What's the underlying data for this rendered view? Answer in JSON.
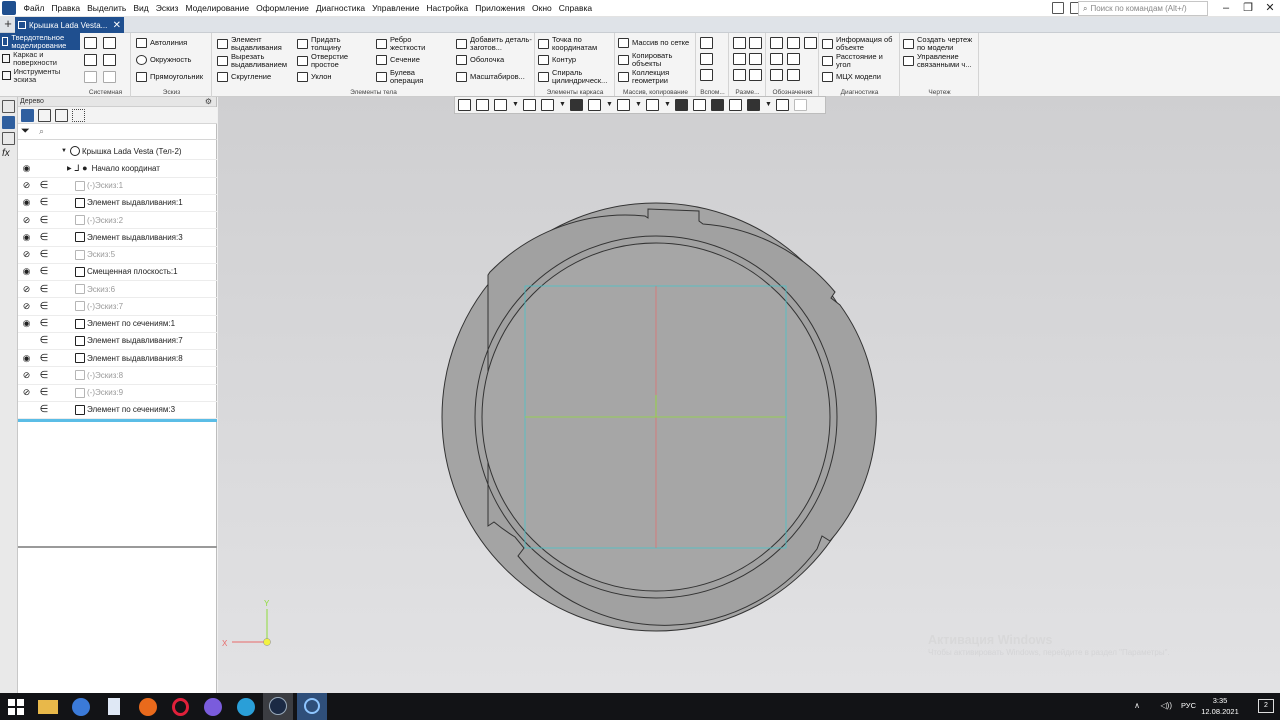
{
  "menubar": {
    "items": [
      "Файл",
      "Правка",
      "Выделить",
      "Вид",
      "Эскиз",
      "Моделирование",
      "Оформление",
      "Диагностика",
      "Управление",
      "Настройка",
      "Приложения",
      "Окно",
      "Справка"
    ],
    "search_placeholder": "Поиск по командам (Alt+/)"
  },
  "tabbar": {
    "doc_tab": "Крышка Lada Vesta...",
    "close_glyph": "✕",
    "plus_glyph": "+"
  },
  "ribbon": {
    "modes": [
      "Твердотельное моделирование",
      "Каркас и поверхности",
      "Инструменты эскиза"
    ],
    "groups": {
      "system": "Системная",
      "sketch": "Эскиз",
      "body_elements": "Элементы тела",
      "frame_elements": "Элементы каркаса",
      "arrays": "Массив, копирование",
      "aux": "Вспом...",
      "dims": "Разме...",
      "notation": "Обозначения",
      "diag": "Диагностика",
      "drawing": "Чертеж"
    },
    "sketch_buttons": [
      "Автолиния",
      "Окружность",
      "Прямоугольник"
    ],
    "body_buttons": {
      "extrude": "Элемент выдавливания",
      "cut_extrude": "Вырезать выдавливанием",
      "fillet": "Скругление",
      "shell_thickness": "Придать толщину",
      "hole": "Отверстие простое",
      "draft": "Уклон",
      "rib": "Ребро жесткости",
      "section": "Сечение",
      "boolean": "Булева операция",
      "add_blank": "Добавить деталь-заготов...",
      "shell": "Оболочка",
      "scale": "Масштабиров..."
    },
    "frame_buttons": [
      "Точка по координатам",
      "Контур",
      "Спираль цилиндрическ..."
    ],
    "array_buttons": [
      "Массив по сетке",
      "Копировать объекты",
      "Коллекция геометрии"
    ],
    "diag_buttons": [
      "Информация об объекте",
      "Расстояние и угол",
      "МЦХ модели"
    ],
    "drawing_buttons": [
      "Создать чертеж по модели",
      "Управление связанными ч..."
    ]
  },
  "tree": {
    "header": "Дерево",
    "gear": "⚙",
    "filter_glyph": "⏷",
    "search_glyph": "⌕",
    "root": "Крышка Lada Vesta (Тел-2)",
    "origin": "Начало координат",
    "rows": [
      {
        "name": "(-)Эскиз:1",
        "eye": "⊘",
        "e": "∈",
        "grey": true
      },
      {
        "name": "Элемент выдавливания:1",
        "eye": "◉",
        "e": "∈",
        "grey": false
      },
      {
        "name": "(-)Эскиз:2",
        "eye": "⊘",
        "e": "∈",
        "grey": true
      },
      {
        "name": "Элемент выдавливания:3",
        "eye": "◉",
        "e": "∈",
        "grey": false
      },
      {
        "name": "Эскиз:5",
        "eye": "⊘",
        "e": "∈",
        "grey": true
      },
      {
        "name": "Смещенная плоскость:1",
        "eye": "◉",
        "e": "∈",
        "grey": false
      },
      {
        "name": "Эскиз:6",
        "eye": "⊘",
        "e": "∈",
        "grey": true
      },
      {
        "name": "(-)Эскиз:7",
        "eye": "⊘",
        "e": "∈",
        "grey": true
      },
      {
        "name": "Элемент по сечениям:1",
        "eye": "◉",
        "e": "∈",
        "grey": false
      },
      {
        "name": "Элемент выдавливания:7",
        "eye": "",
        "e": "∈",
        "grey": false
      },
      {
        "name": "Элемент выдавливания:8",
        "eye": "◉",
        "e": "∈",
        "grey": false
      },
      {
        "name": "(-)Эскиз:8",
        "eye": "⊘",
        "e": "∈",
        "grey": true
      },
      {
        "name": "(-)Эскиз:9",
        "eye": "⊘",
        "e": "∈",
        "grey": true
      },
      {
        "name": "Элемент по сечениям:3",
        "eye": "",
        "e": "∈",
        "grey": false
      }
    ]
  },
  "viewport": {
    "axis_x": "X",
    "axis_y": "Y",
    "watermark_title": "Активация Windows",
    "watermark_sub": "Чтобы активировать Windows, перейдите в раздел \"Параметры\"."
  },
  "taskbar": {
    "lang": "РУС",
    "time": "3:35",
    "date": "12.08.2021",
    "notify": "2",
    "tray": [
      "∧",
      "◁))",
      "⌂"
    ]
  },
  "colors": {
    "accent": "#1f4f8f",
    "model_fill": "#a4a4a4",
    "sketch_frame": "#46c3c9",
    "axis_red": "#e86a6a",
    "axis_green": "#8fdc3c"
  }
}
